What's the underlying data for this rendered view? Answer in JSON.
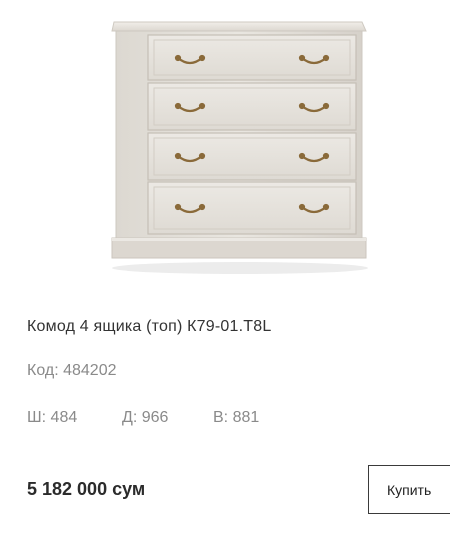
{
  "product": {
    "image_label": "",
    "title": "Комод 4 ящика (топ) К79-01.T8L",
    "code": "Код: 484202",
    "dimensions": {
      "width": "Ш: 484",
      "depth": "Д: 966",
      "height": "В: 881"
    },
    "price": "5 182 000 сум",
    "buy_label": "Купить"
  },
  "colors": {
    "furniture_body": "#e6e2dc",
    "handle": "#8a6a3a",
    "muted_text": "#8a8a8a"
  }
}
